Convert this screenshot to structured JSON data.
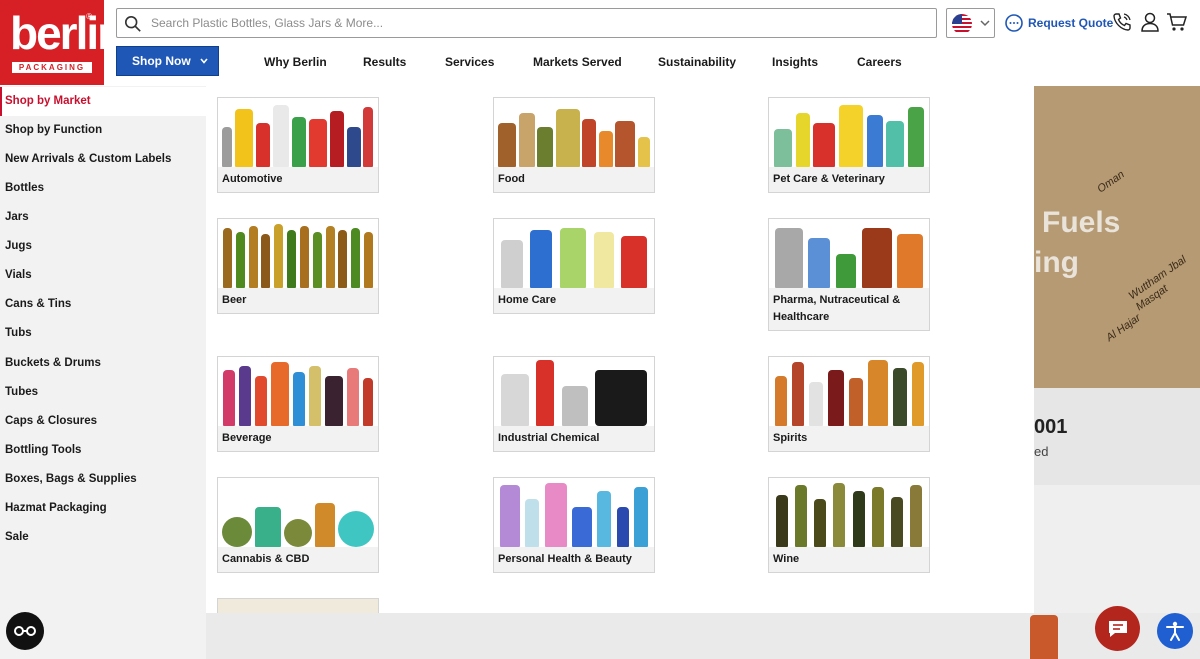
{
  "brand": {
    "logo_word": "berlin",
    "logo_sub": "PACKAGING",
    "logo_reg": "®"
  },
  "search": {
    "placeholder": "Search Plastic Bottles, Glass Jars & More..."
  },
  "header": {
    "request_quote": "Request Quote"
  },
  "nav": {
    "shop_now": "Shop Now",
    "links": [
      "Why Berlin",
      "Results",
      "Services",
      "Markets Served",
      "Sustainability",
      "Insights",
      "Careers"
    ]
  },
  "sidebar": {
    "items": [
      "Shop by Market",
      "Shop by Function",
      "New Arrivals & Custom Labels",
      "Bottles",
      "Jars",
      "Jugs",
      "Vials",
      "Cans & Tins",
      "Tubs",
      "Buckets & Drums",
      "Tubes",
      "Caps & Closures",
      "Bottling Tools",
      "Boxes, Bags & Supplies",
      "Hazmat Packaging",
      "Sale"
    ],
    "active": "Shop by Market"
  },
  "markets": [
    {
      "label": "Automotive"
    },
    {
      "label": "Food"
    },
    {
      "label": "Pet Care & Veterinary"
    },
    {
      "label": "Beer"
    },
    {
      "label": "Home Care"
    },
    {
      "label": "Pharma, Nutraceutical & Healthcare"
    },
    {
      "label": "Beverage"
    },
    {
      "label": "Industrial Chemical"
    },
    {
      "label": "Spirits"
    },
    {
      "label": "Cannabis & CBD"
    },
    {
      "label": "Personal Health & Beauty"
    },
    {
      "label": "Wine"
    }
  ],
  "background": {
    "hero_line1": "Fuels",
    "hero_line2": "ing",
    "stat_number": "001",
    "stat_text": "ed",
    "map_labels": [
      "Oman",
      "Wuttham Jbal",
      "Masqat",
      "Al Hajar"
    ]
  },
  "colors": {
    "brand_red": "#d71f26",
    "brand_blue": "#1f57b6",
    "active_red": "#c8102e"
  }
}
